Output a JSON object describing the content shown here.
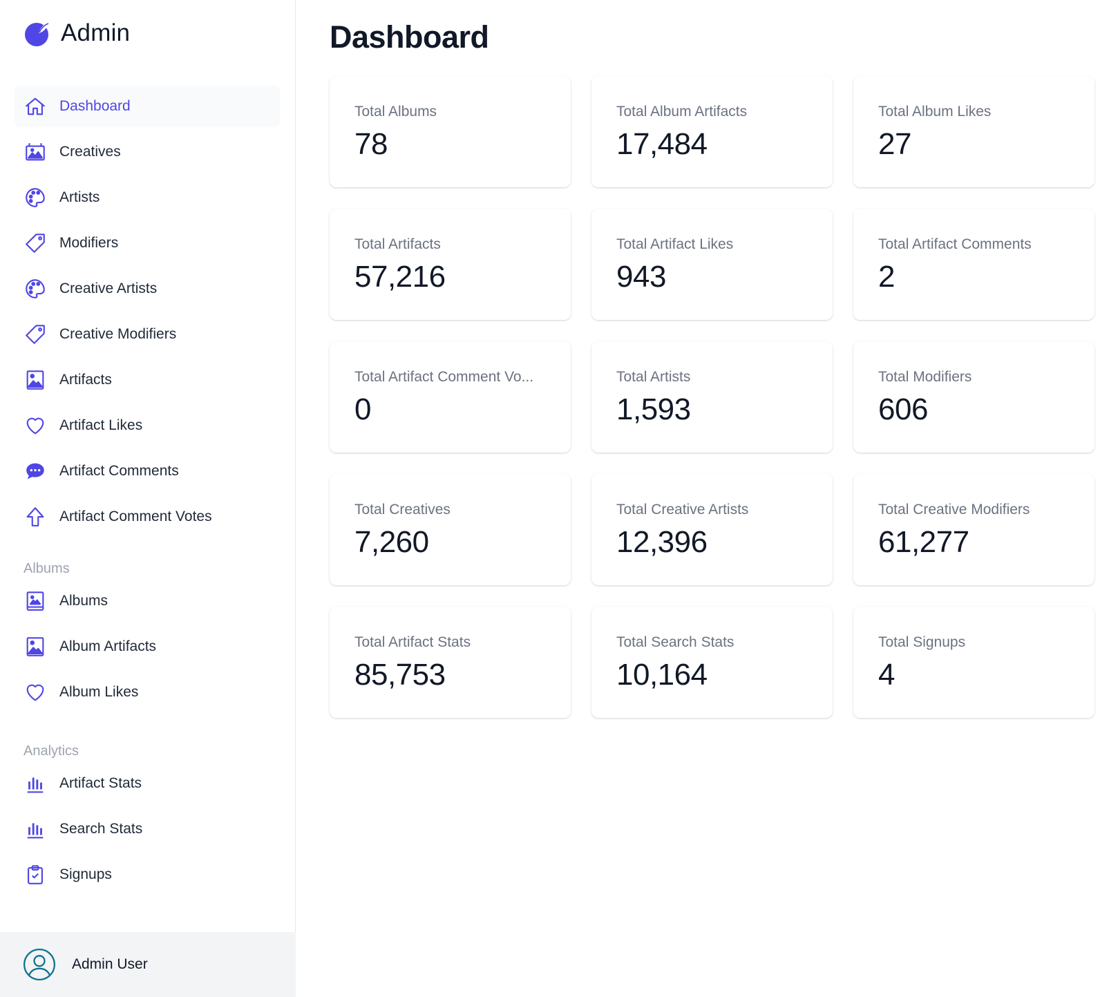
{
  "brand": {
    "name": "Admin"
  },
  "page": {
    "title": "Dashboard"
  },
  "sidebar": {
    "main_items": [
      {
        "label": "Dashboard",
        "icon": "home-icon"
      },
      {
        "label": "Creatives",
        "icon": "gallery-icon"
      },
      {
        "label": "Artists",
        "icon": "palette-icon"
      },
      {
        "label": "Modifiers",
        "icon": "tag-icon"
      },
      {
        "label": "Creative Artists",
        "icon": "palette-icon"
      },
      {
        "label": "Creative Modifiers",
        "icon": "tag-icon"
      },
      {
        "label": "Artifacts",
        "icon": "image-icon"
      },
      {
        "label": "Artifact Likes",
        "icon": "heart-icon"
      },
      {
        "label": "Artifact Comments",
        "icon": "chat-bubble-icon"
      },
      {
        "label": "Artifact Comment Votes",
        "icon": "arrow-up-icon"
      }
    ],
    "albums_section": {
      "title": "Albums",
      "items": [
        {
          "label": "Albums",
          "icon": "photo-album-icon"
        },
        {
          "label": "Album Artifacts",
          "icon": "image-icon"
        },
        {
          "label": "Album Likes",
          "icon": "heart-icon"
        }
      ]
    },
    "analytics_section": {
      "title": "Analytics",
      "items": [
        {
          "label": "Artifact Stats",
          "icon": "bar-chart-icon"
        },
        {
          "label": "Search Stats",
          "icon": "bar-chart-icon"
        },
        {
          "label": "Signups",
          "icon": "clipboard-check-icon"
        }
      ]
    },
    "user": {
      "name": "Admin User",
      "icon": "user-circle-icon"
    }
  },
  "stats": [
    {
      "label": "Total Albums",
      "value": "78"
    },
    {
      "label": "Total Album Artifacts",
      "value": "17,484"
    },
    {
      "label": "Total Album Likes",
      "value": "27"
    },
    {
      "label": "Total Artifacts",
      "value": "57,216"
    },
    {
      "label": "Total Artifact Likes",
      "value": "943"
    },
    {
      "label": "Total Artifact Comments",
      "value": "2"
    },
    {
      "label": "Total Artifact Comment Vo...",
      "value": "0"
    },
    {
      "label": "Total Artists",
      "value": "1,593"
    },
    {
      "label": "Total Modifiers",
      "value": "606"
    },
    {
      "label": "Total Creatives",
      "value": "7,260"
    },
    {
      "label": "Total Creative Artists",
      "value": "12,396"
    },
    {
      "label": "Total Creative Modifiers",
      "value": "61,277"
    },
    {
      "label": "Total Artifact Stats",
      "value": "85,753"
    },
    {
      "label": "Total Search Stats",
      "value": "10,164"
    },
    {
      "label": "Total Signups",
      "value": "4"
    }
  ],
  "colors": {
    "accent": "#4f46e5",
    "user_icon": "#0e7490",
    "muted_text": "#6b7280",
    "section_title": "#9ca3af"
  }
}
